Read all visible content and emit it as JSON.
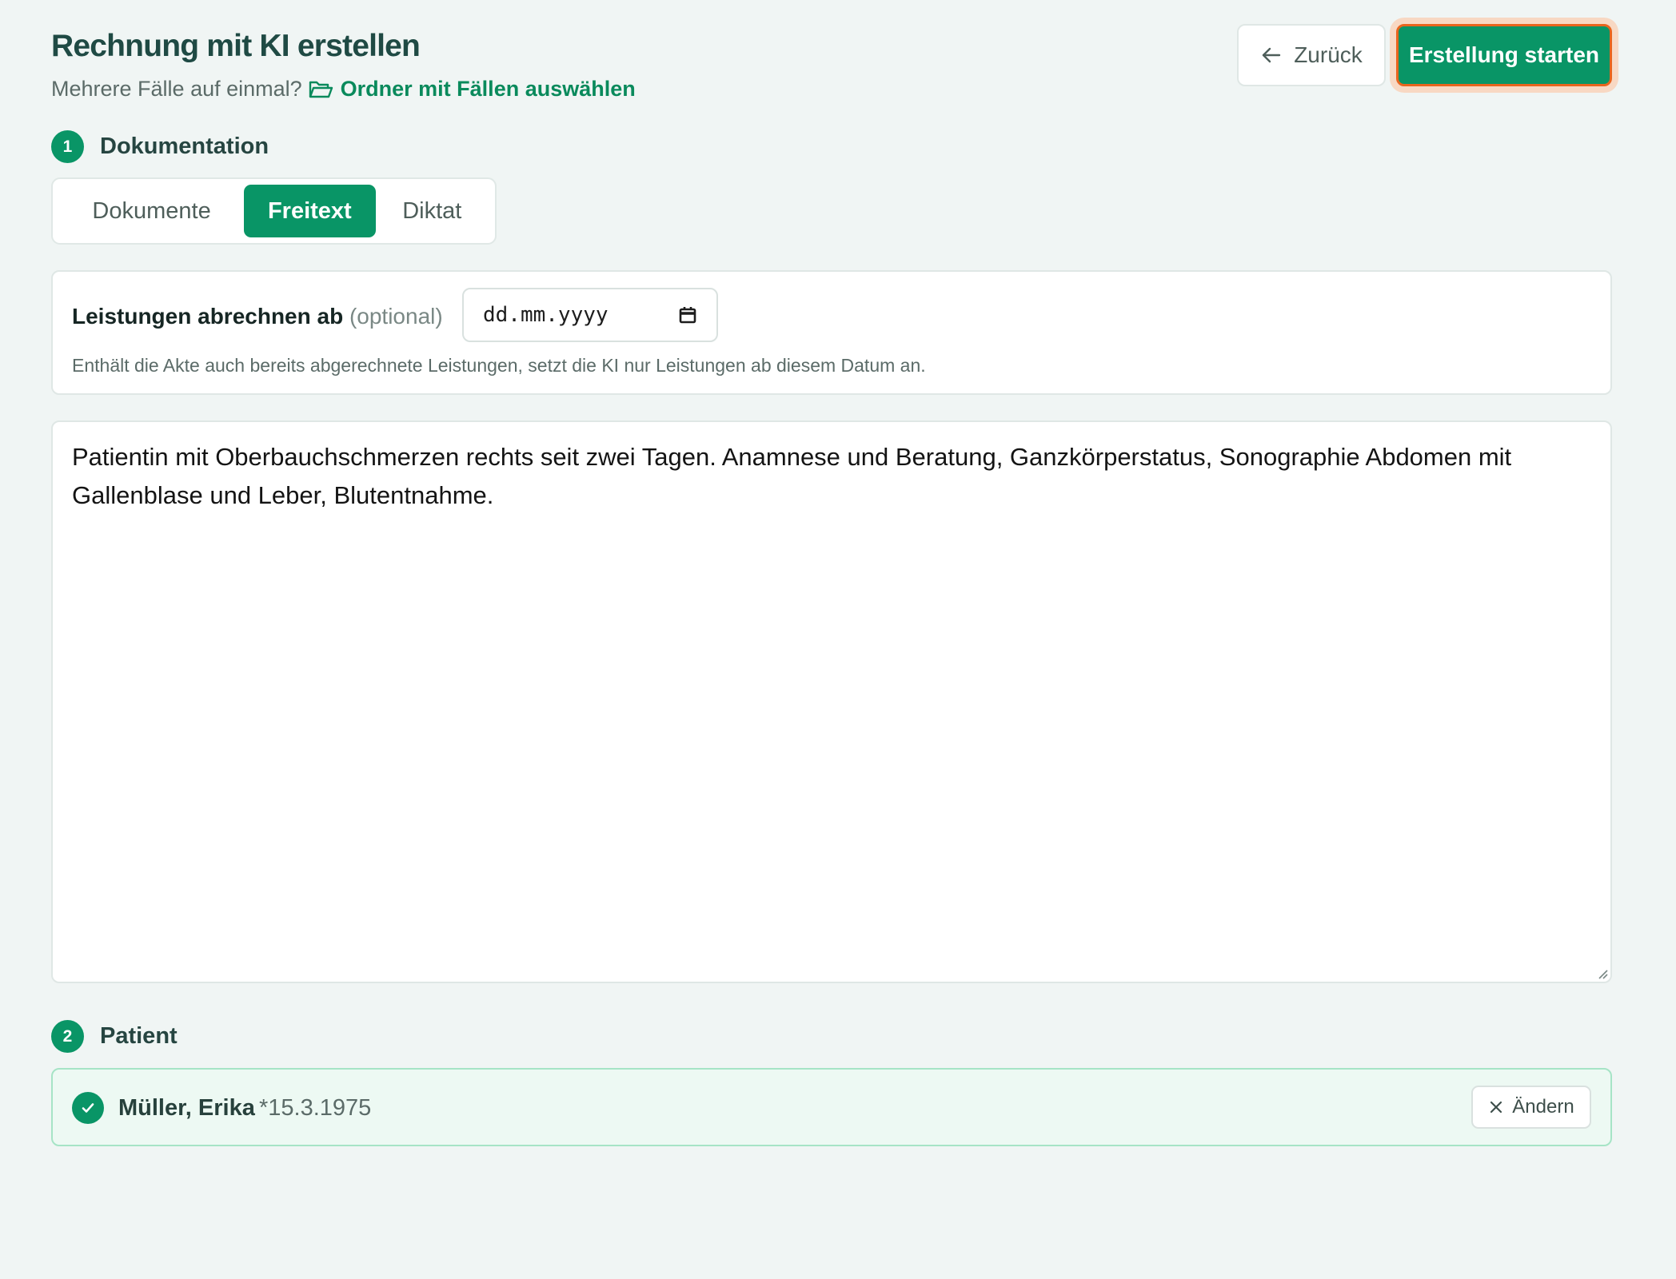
{
  "header": {
    "title": "Rechnung mit KI erstellen",
    "subtitle_prefix": "Mehrere Fälle auf einmal?",
    "folder_link": "Ordner mit Fällen auswählen",
    "back_label": "Zurück",
    "start_label": "Erstellung starten"
  },
  "sections": {
    "documentation": {
      "step": "1",
      "title": "Dokumentation"
    },
    "patient": {
      "step": "2",
      "title": "Patient"
    }
  },
  "tabs": [
    {
      "label": "Dokumente",
      "active": false
    },
    {
      "label": "Freitext",
      "active": true
    },
    {
      "label": "Diktat",
      "active": false
    }
  ],
  "billing_date": {
    "label": "Leistungen abrechnen ab",
    "optional": "(optional)",
    "placeholder": "dd.mm.yyyy",
    "help": "Enthält die Akte auch bereits abgerechnete Leistungen, setzt die KI nur Leistungen ab diesem Datum an."
  },
  "freetext": {
    "value": "Patientin mit Oberbauchschmerzen rechts seit zwei Tagen. Anamnese und Beratung, Ganzkörperstatus, Sonographie Abdomen mit Gallenblase und Leber, Blutentnahme."
  },
  "patient": {
    "name": "Müller, Erika",
    "dob": "*15.3.1975",
    "change_label": "Ändern"
  },
  "colors": {
    "accent": "#099566",
    "focus_ring": "#e8651e",
    "background": "#f0f5f4",
    "patient_bg": "#edf9f3"
  },
  "icons": {
    "folder": "folder-open-icon",
    "back": "arrow-left-icon",
    "calendar": "calendar-icon",
    "check": "check-circle-icon",
    "close": "close-icon"
  }
}
